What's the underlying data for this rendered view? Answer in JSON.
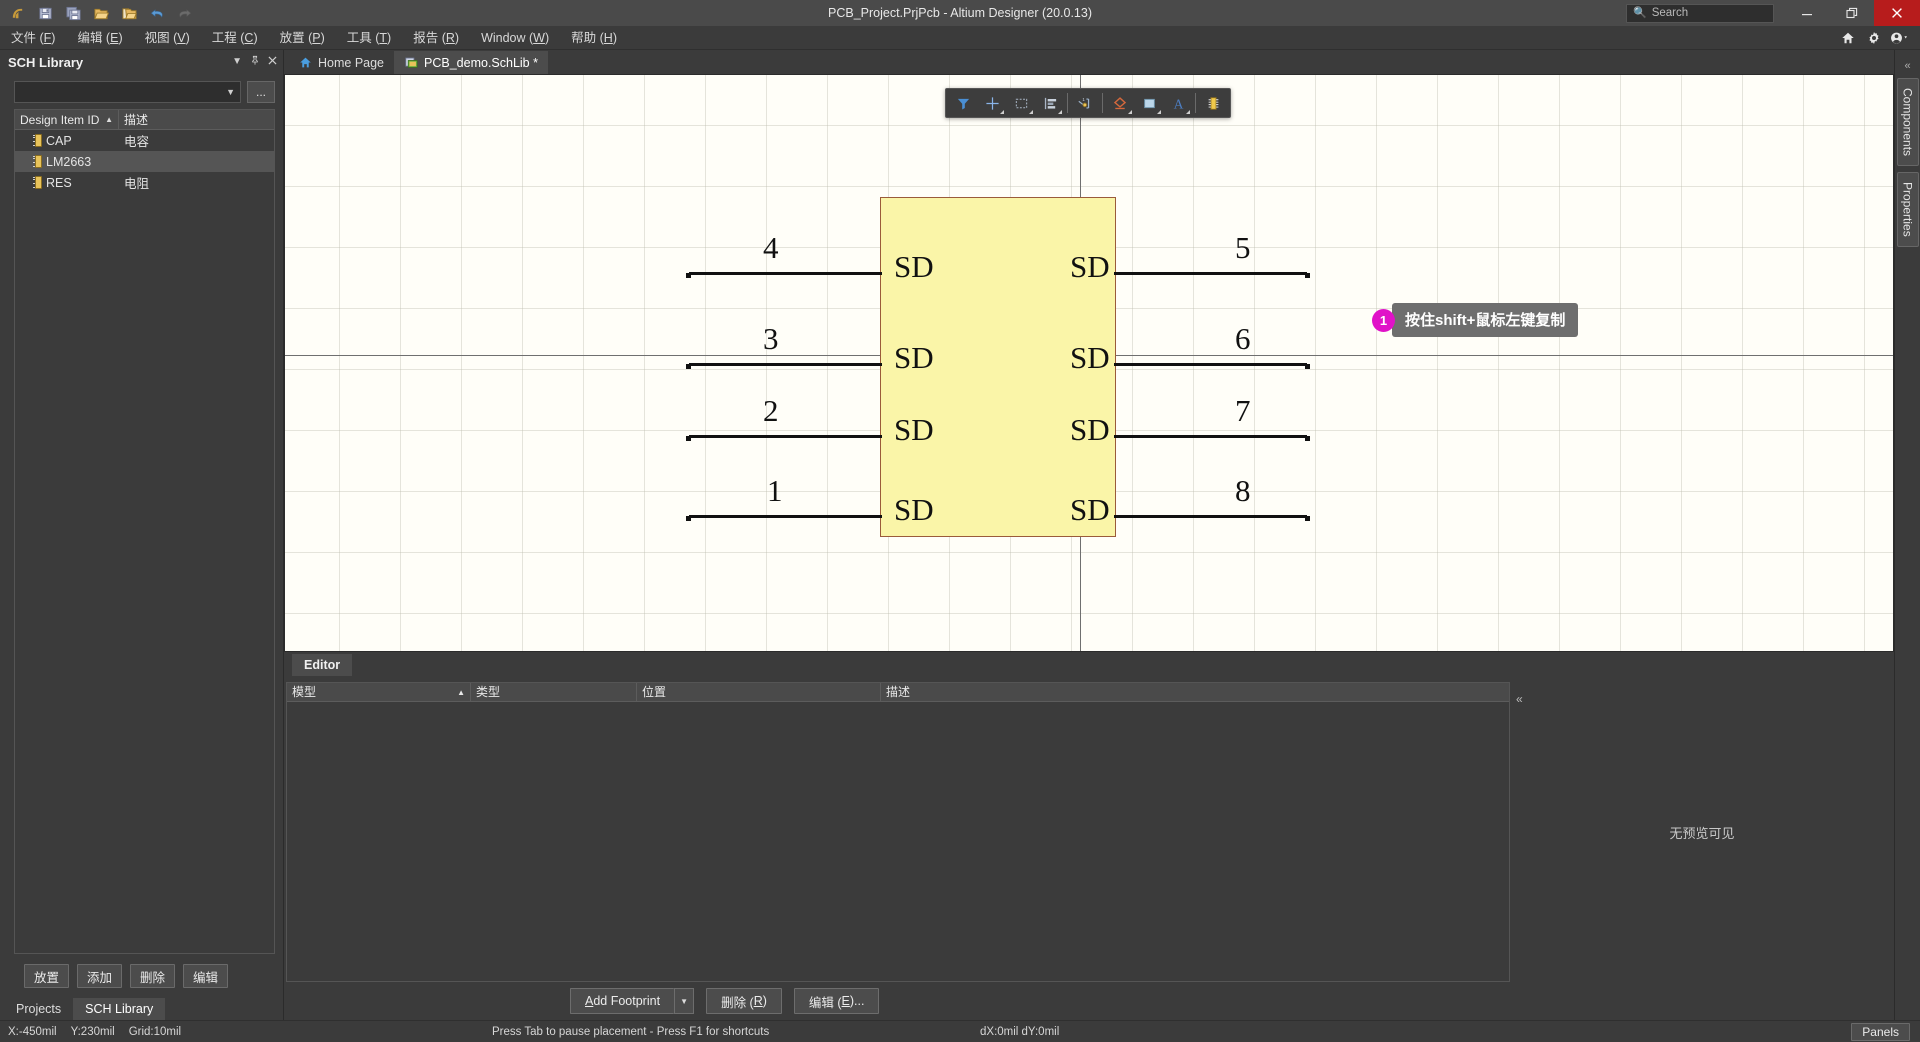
{
  "titlebar": {
    "title": "PCB_Project.PrjPcb - Altium Designer (20.0.13)",
    "quick_access": [
      {
        "name": "altium-logo-icon",
        "label": "Altium"
      },
      {
        "name": "save-icon",
        "label": "Save"
      },
      {
        "name": "save-all-icon",
        "label": "Save All"
      },
      {
        "name": "open-icon",
        "label": "Open"
      },
      {
        "name": "open-project-icon",
        "label": "Open Project"
      },
      {
        "name": "undo-icon",
        "label": "Undo"
      },
      {
        "name": "redo-icon",
        "label": "Redo"
      }
    ],
    "search": {
      "placeholder": "Search",
      "value": "",
      "icon": "search-icon"
    },
    "window_controls": {
      "minimize": "—",
      "restore": "❐",
      "close": "✕",
      "close_color": "#b71c1c"
    }
  },
  "menubar": {
    "items": [
      {
        "text": "文件",
        "accel": "F"
      },
      {
        "text": "编辑",
        "accel": "E"
      },
      {
        "text": "视图",
        "accel": "V"
      },
      {
        "text": "工程",
        "accel": "C"
      },
      {
        "text": "放置",
        "accel": "P"
      },
      {
        "text": "工具",
        "accel": "T"
      },
      {
        "text": "报告",
        "accel": "R"
      },
      {
        "text": "Window",
        "accel": "W"
      },
      {
        "text": "帮助",
        "accel": "H"
      }
    ],
    "right_icons": [
      {
        "name": "home-icon"
      },
      {
        "name": "gear-icon"
      },
      {
        "name": "account-icon"
      }
    ]
  },
  "left_panel": {
    "title": "SCH Library",
    "header_icons": [
      {
        "name": "chevron-down-icon",
        "glyph": "▼"
      },
      {
        "name": "pin-icon",
        "glyph": "✦"
      },
      {
        "name": "close-icon",
        "glyph": "✕"
      }
    ],
    "library_select": {
      "value": "",
      "placeholder": "",
      "ellipsis_label": "..."
    },
    "table": {
      "columns": [
        "Design Item ID",
        "描述"
      ],
      "sorted_column": "Design Item ID",
      "sort_direction": "asc",
      "rows": [
        {
          "id": "CAP",
          "desc": "电容",
          "selected": false
        },
        {
          "id": "LM2663",
          "desc": "",
          "selected": true
        },
        {
          "id": "RES",
          "desc": "电阻",
          "selected": false
        }
      ]
    },
    "buttons": [
      {
        "label": "放置",
        "name": "place-button"
      },
      {
        "label": "添加",
        "name": "add-button"
      },
      {
        "label": "删除",
        "name": "delete-button"
      },
      {
        "label": "编辑",
        "name": "edit-button"
      }
    ],
    "tabs": [
      {
        "label": "Projects",
        "active": false
      },
      {
        "label": "SCH Library",
        "active": true
      }
    ]
  },
  "document_tabs": [
    {
      "label": "Home Page",
      "icon": "home-icon",
      "active": false
    },
    {
      "label": "PCB_demo.SchLib *",
      "icon": "schlib-icon",
      "active": true
    }
  ],
  "canvas_toolbar": {
    "buttons": [
      {
        "name": "filter-icon",
        "label": "Filter"
      },
      {
        "name": "crosshair-icon",
        "label": "Place Crosshair"
      },
      {
        "name": "select-rectangle-icon",
        "label": "Select Area"
      },
      {
        "name": "align-icon",
        "label": "Align"
      },
      {
        "name": "place-pin-icon",
        "label": "Place Pin"
      },
      {
        "name": "place-polygon-icon",
        "label": "Place Polygon"
      },
      {
        "name": "place-rectangle-icon",
        "label": "Place Rectangle"
      },
      {
        "name": "place-text-icon",
        "label": "Place Text String"
      },
      {
        "name": "place-component-icon",
        "label": "Place Component"
      }
    ]
  },
  "symbol": {
    "name": "LM2663",
    "body_color": "#faf5a8",
    "border_color": "#9a5b3a",
    "left_pins": [
      {
        "number": "4",
        "name": "SD"
      },
      {
        "number": "3",
        "name": "SD"
      },
      {
        "number": "2",
        "name": "SD"
      },
      {
        "number": "1",
        "name": "SD"
      }
    ],
    "right_pins": [
      {
        "number": "5",
        "name": "SD"
      },
      {
        "number": "6",
        "name": "SD"
      },
      {
        "number": "7",
        "name": "SD"
      },
      {
        "number": "8",
        "name": "SD"
      }
    ]
  },
  "tooltip": {
    "badge": "1",
    "text": "按住shift+鼠标左键复制",
    "badge_color": "#e012c8"
  },
  "editor_panel": {
    "tabs": [
      {
        "label": "Editor",
        "active": true
      }
    ],
    "model_table": {
      "columns": [
        "模型",
        "类型",
        "位置",
        "描述"
      ],
      "sorted_column": "模型",
      "rows": []
    },
    "preview_text": "无预览可见",
    "buttons": [
      {
        "label": "Add Footprint",
        "accel": "A",
        "name": "add-footprint-button",
        "has_dropdown": true
      },
      {
        "label": "删除",
        "accel": "R",
        "name": "delete-model-button",
        "has_dropdown": false
      },
      {
        "label": "编辑",
        "accel": "E",
        "suffix": "...",
        "name": "edit-model-button",
        "has_dropdown": false
      }
    ]
  },
  "right_dock": {
    "tabs": [
      {
        "label": "Components",
        "name": "components-panel-tab"
      },
      {
        "label": "Properties",
        "name": "properties-panel-tab"
      }
    ],
    "collapse_glyph": "«"
  },
  "statusbar": {
    "x": "X:-450mil",
    "y": "Y:230mil",
    "grid": "Grid:10mil",
    "hint": "Press Tab to pause placement - Press F1 for shortcuts",
    "delta": "dX:0mil dY:0mil",
    "panels_label": "Panels"
  }
}
